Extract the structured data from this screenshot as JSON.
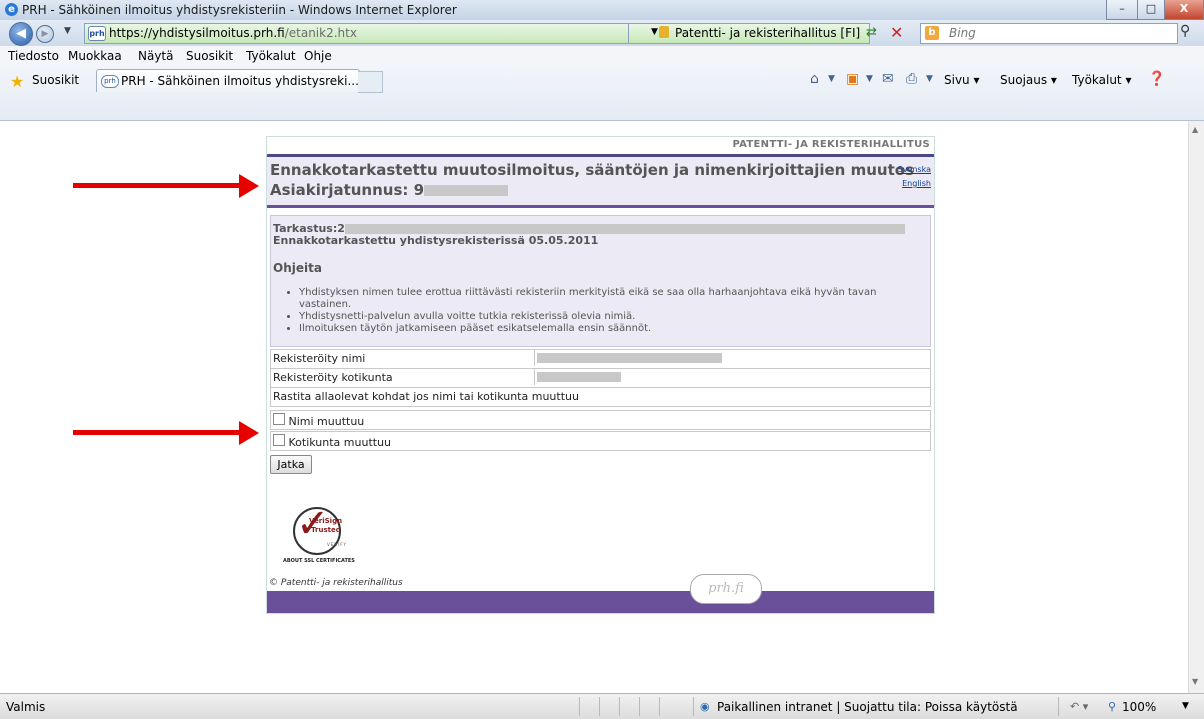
{
  "window": {
    "title": "PRH - Sähköinen ilmoitus yhdistysrekisteriin - Windows Internet Explorer",
    "controls": [
      "–",
      "□",
      "X"
    ]
  },
  "address": {
    "url_host": "https://yhdistysilmoitus.prh.fi",
    "url_path": "/etanik2.htx",
    "cert_org": "Patentti- ja rekisterihallitus [FI]",
    "search_placeholder": "Bing"
  },
  "menu": {
    "items": [
      "Tiedosto",
      "Muokkaa",
      "Näytä",
      "Suosikit",
      "Työkalut",
      "Ohje"
    ]
  },
  "favorites": {
    "label": "Suosikit",
    "tab_title": "PRH - Sähköinen ilmoitus yhdistysreki...",
    "commands": [
      "Sivu",
      "Suojaus",
      "Työkalut"
    ]
  },
  "page": {
    "brand": "PATENTTI- JA REKISTERIHALLITUS",
    "heading": "Ennakkotarkastettu muutosilmoitus, sääntöjen ja nimenkirjoittajien muutos",
    "doc_label": "Asiakirjatunnus:",
    "doc_partial": "9",
    "lang_sv": "Svenska",
    "lang_en": "English",
    "tarkastus_label": "Tarkastus:2",
    "pre_checked": "Ennakkotarkastettu yhdistysrekisterissä 05.05.2011",
    "instructions_title": "Ohjeita",
    "instructions": [
      "Yhdistyksen nimen tulee erottua riittävästi rekisteriin merkityistä eikä se saa olla harhaanjohtava eikä hyvän tavan vastainen.",
      "Yhdistysnetti-palvelun avulla voitte tutkia rekisterissä olevia nimiä.",
      "Ilmoituksen täytön jatkamiseen pääset esikatselemalla ensin säännöt."
    ],
    "registered_name_label": "Rekisteröity nimi",
    "registered_municipality_label": "Rekisteröity kotikunta",
    "check_prompt": "Rastita allaolevat kohdat jos nimi tai kotikunta muuttuu",
    "checkbox_name": "Nimi muuttuu",
    "checkbox_municipality": "Kotikunta muuttuu",
    "continue_button": "Jatka",
    "seal_line1": "VeriSign",
    "seal_line2": "Trusted",
    "seal_verify": "VERIFY",
    "seal_about": "ABOUT SSL CERTIFICATES",
    "copyright": "© Patentti- ja rekisterihallitus",
    "footer_logo": "prh.fi"
  },
  "status": {
    "left": "Valmis",
    "zone": "Paikallinen intranet | Suojattu tila: Poissa käytöstä",
    "zoom": "100%"
  },
  "colors": {
    "accent_purple": "#6a4f9a",
    "arrow_red": "#e60000",
    "header_bg": "#ebeaf5"
  }
}
